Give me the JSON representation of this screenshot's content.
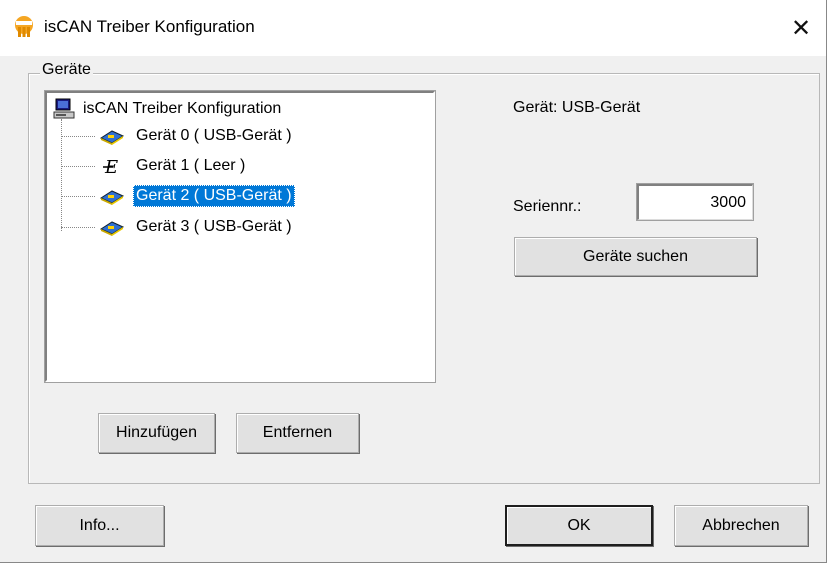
{
  "window": {
    "title": "isCAN Treiber Konfiguration",
    "close_label": "✕"
  },
  "group": {
    "label": "Geräte"
  },
  "tree": {
    "root_label": "isCAN Treiber Konfiguration",
    "items": [
      {
        "label": "Gerät 0  ( USB-Gerät )",
        "icon": "usb-device-icon",
        "selected": false
      },
      {
        "label": "Gerät 1  ( Leer )",
        "icon": "empty-device-icon",
        "selected": false
      },
      {
        "label": "Gerät 2  ( USB-Gerät )",
        "icon": "usb-device-icon",
        "selected": true
      },
      {
        "label": "Gerät 3  ( USB-Gerät )",
        "icon": "usb-device-icon",
        "selected": false
      }
    ]
  },
  "details": {
    "device_type": "Gerät: USB-Gerät",
    "serial_label": "Seriennr.:",
    "serial_value": "3000",
    "search_button": "Geräte suchen"
  },
  "buttons": {
    "add": "Hinzufügen",
    "remove": "Entfernen",
    "info": "Info...",
    "ok": "OK",
    "cancel": "Abbrechen"
  },
  "colors": {
    "selection": "#0078d7",
    "app_icon": "#f0a020"
  }
}
